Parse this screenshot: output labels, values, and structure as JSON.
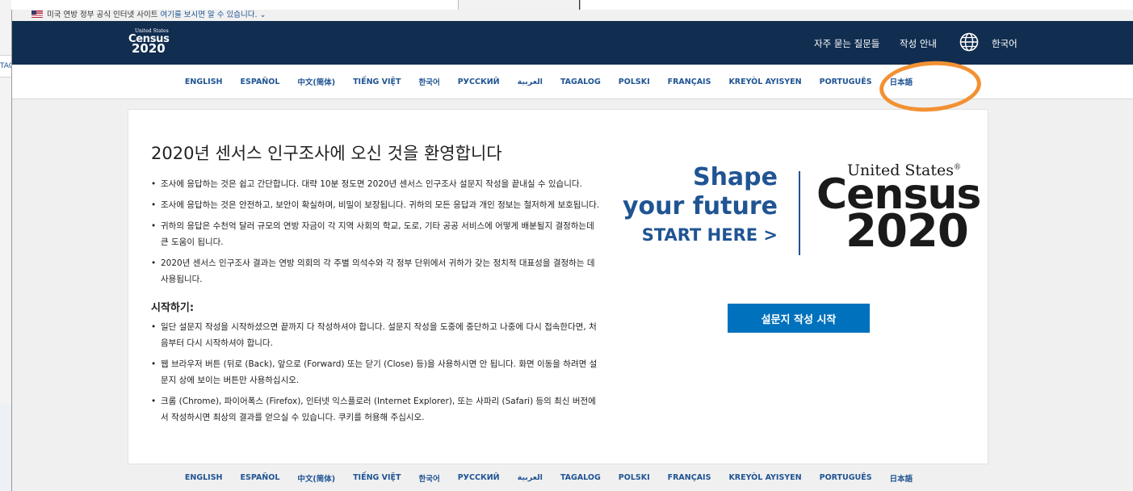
{
  "gov_banner": {
    "text": "미국 연방 정부 공식 인터넷 사이트",
    "link": "여기를 보시면 알 수 있습니다."
  },
  "background": {
    "left_fragment": "TAG"
  },
  "header": {
    "logo_us": "United States",
    "logo_census": "Census",
    "logo_year": "2020",
    "faq": "자주 묻는 질문들",
    "guide": "작성 안내",
    "current_language": "한국어"
  },
  "languages": [
    "ENGLISH",
    "ESPAÑOL",
    "中文(简体)",
    "TIẾNG VIỆT",
    "한국어",
    "РУССКИЙ",
    "العربية",
    "TAGALOG",
    "POLSKI",
    "FRANÇAIS",
    "KREYÒL AYISYEN",
    "PORTUGUÊS",
    "日本語"
  ],
  "card": {
    "title": "2020년 센서스 인구조사에 오신 것을 환영합니다",
    "intro_bullets": [
      "조사에 응답하는 것은 쉽고 간단합니다. 대략 10분 정도면 2020년 센서스 인구조사 설문지 작성을 끝내실 수 있습니다.",
      "조사에 응답하는 것은 안전하고, 보안이 확실하며, 비밀이 보장됩니다. 귀하의 모든 응답과 개인 정보는 철저하게 보호됩니다.",
      "귀하의 응답은 수천억 달러 규모의 연방 자금이 각 지역 사회의 학교, 도로, 기타 공공 서비스에 어떻게 배분될지 결정하는데 큰 도움이 됩니다.",
      "2020년 센서스 인구조사 결과는 연방 의회의 각 주별 의석수와 각 정부 단위에서 귀하가 갖는 정치적 대표성을 결정하는 데 사용됩니다."
    ],
    "start_heading": "시작하기:",
    "start_bullets": [
      "일단 설문지 작성을 시작하셨으면 끝까지 다 작성하셔야 합니다. 설문지 작성을 도중에 중단하고 나중에 다시 접속한다면, 처음부터 다시 시작하셔야 합니다.",
      "웹 브라우저 버튼 (뒤로 (Back), 앞으로 (Forward) 또는 닫기 (Close) 등)을 사용하시면 안 됩니다. 화면 이동을 하려면 설문지 상에 보이는 버튼만 사용하십시오.",
      "크롬 (Chrome), 파이어폭스 (Firefox), 인터넷 익스플로러 (Internet Explorer), 또는 사파리 (Safari) 등의 최신 버전에서 작성하시면 최상의 결과를 얻으실 수 있습니다. 쿠키를 허용해 주십시오."
    ],
    "promo_line1": "Shape",
    "promo_line2": "your future",
    "promo_line3": "START HERE >",
    "promo_logo_us": "United States",
    "promo_logo_census": "Census",
    "promo_logo_year": "2020",
    "start_button": "설문지 작성 시작"
  },
  "colors": {
    "header_bg": "#112e51",
    "link": "#205493",
    "button": "#0071bc",
    "highlight": "#f29133"
  },
  "icons": {
    "globe": "globe-icon",
    "flag": "us-flag-icon"
  }
}
